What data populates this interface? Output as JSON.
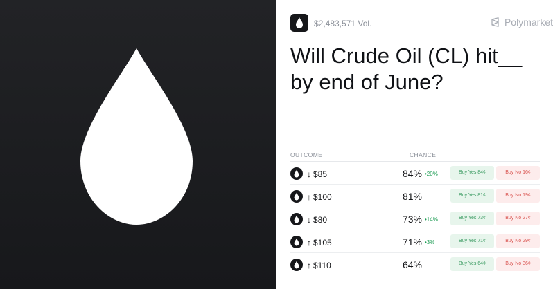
{
  "header": {
    "volume": "$2,483,571 Vol.",
    "brand": "Polymarket",
    "icon": "oil-drop-icon"
  },
  "question": "Will Crude Oil (CL) hit__ by end of June?",
  "table": {
    "outcome_header": "OUTCOME",
    "chance_header": "CHANCE",
    "rows": [
      {
        "arrow": "↓",
        "label": "$85",
        "chance": "84%",
        "delta": "•20%",
        "yes": "Buy Yes 84¢",
        "no": "Buy No 16¢"
      },
      {
        "arrow": "↑",
        "label": "$100",
        "chance": "81%",
        "delta": "",
        "yes": "Buy Yes 81¢",
        "no": "Buy No 19¢"
      },
      {
        "arrow": "↓",
        "label": "$80",
        "chance": "73%",
        "delta": "•14%",
        "yes": "Buy Yes 73¢",
        "no": "Buy No 27¢"
      },
      {
        "arrow": "↑",
        "label": "$105",
        "chance": "71%",
        "delta": "•3%",
        "yes": "Buy Yes 71¢",
        "no": "Buy No 29¢"
      },
      {
        "arrow": "↑",
        "label": "$110",
        "chance": "64%",
        "delta": "",
        "yes": "Buy Yes 64¢",
        "no": "Buy No 36¢"
      }
    ]
  },
  "colors": {
    "dark_panel": "#1c1d20",
    "yes_bg": "#e7f5ec",
    "yes_text": "#3b9b62",
    "no_bg": "#fdecec",
    "no_text": "#d9534f",
    "delta_up": "#1f9d55"
  }
}
